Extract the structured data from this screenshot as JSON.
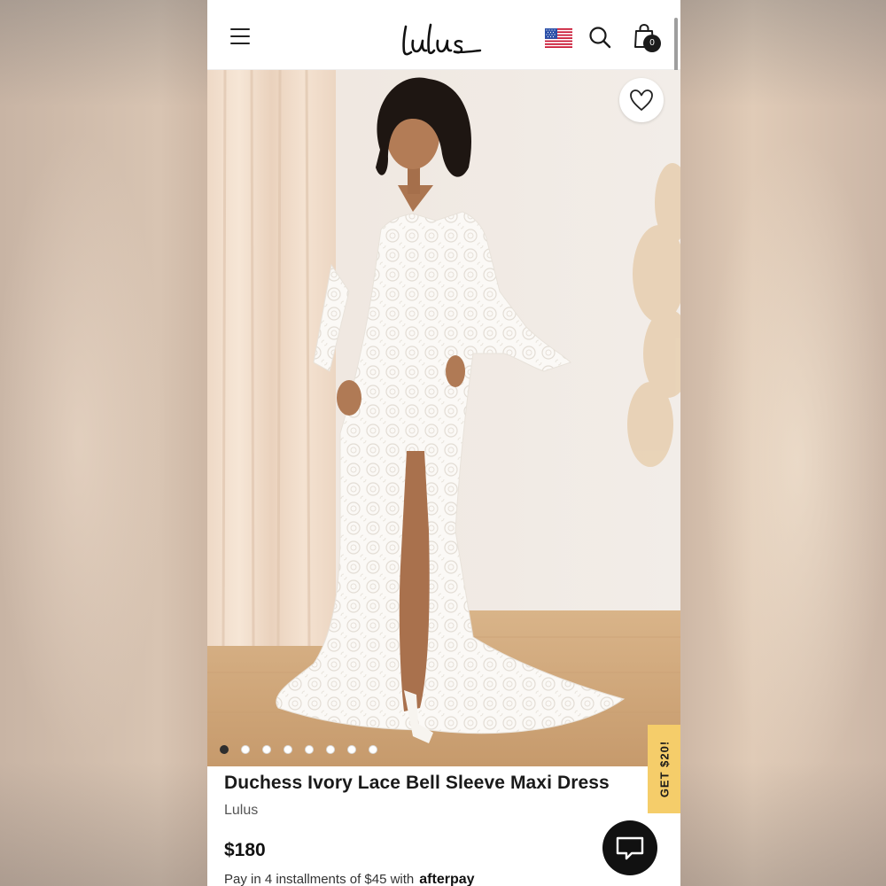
{
  "header": {
    "logo_text": "Lulus",
    "bag_count": "0",
    "icons": [
      "menu-icon",
      "us-flag-icon",
      "search-icon",
      "shopping-bag-icon"
    ]
  },
  "gallery": {
    "image_count": 8,
    "active_index": 0,
    "wishlist_icon": "heart-icon"
  },
  "promo": {
    "label": "GET $20!"
  },
  "product": {
    "title": "Duchess Ivory Lace Bell Sleeve Maxi Dress",
    "brand": "Lulus",
    "price": "$180",
    "installments_text": "Pay in 4 installments of $45 with",
    "afterpay_label": "afterpay"
  },
  "chat": {
    "icon": "chat-icon"
  },
  "colors": {
    "promo_bg": "#f5cd6a",
    "text": "#1a1a1a",
    "chat_bg": "#111111"
  }
}
